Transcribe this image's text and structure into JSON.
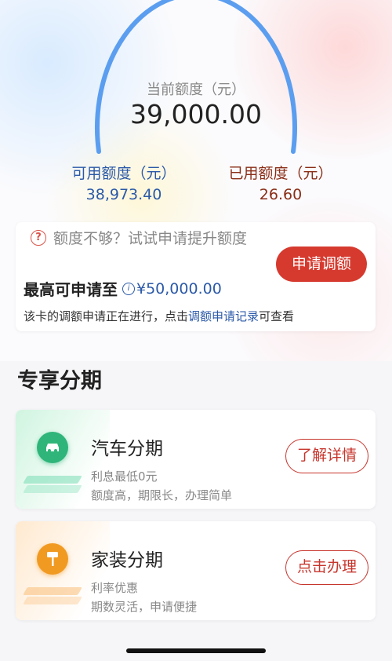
{
  "credit": {
    "current_label": "当前额度（元）",
    "current_value": "39,000.00",
    "available_label": "可用额度（元）",
    "available_value": "38,973.40",
    "used_label": "已用额度（元）",
    "used_value": "26.60",
    "gauge_color": "#5b9ef0"
  },
  "raise_card": {
    "help_icon": "question-circle-icon",
    "prompt": "额度不够？试试申请提升额度",
    "max_label": "最高可申请至",
    "info_icon": "info-circle-icon",
    "max_value": "¥50,000.00",
    "notice_prefix": "该卡的调额申请正在进行，点击",
    "notice_link": "调额申请记录",
    "notice_suffix": "可查看",
    "apply_button": "申请调额",
    "accent_color": "#d63a2f",
    "link_color": "#2b59a8"
  },
  "section": {
    "title": "专享分期"
  },
  "offers": [
    {
      "icon": "car-icon",
      "title": "汽车分期",
      "line1": "利息最低0元",
      "line2": "额度高，期限长，办理简单",
      "button": "了解详情",
      "color": "#2fb579"
    },
    {
      "icon": "paint-roller-icon",
      "title": "家装分期",
      "line1": "利率优惠",
      "line2": "期数灵活，申请便捷",
      "button": "点击办理",
      "color": "#f19a22"
    }
  ]
}
